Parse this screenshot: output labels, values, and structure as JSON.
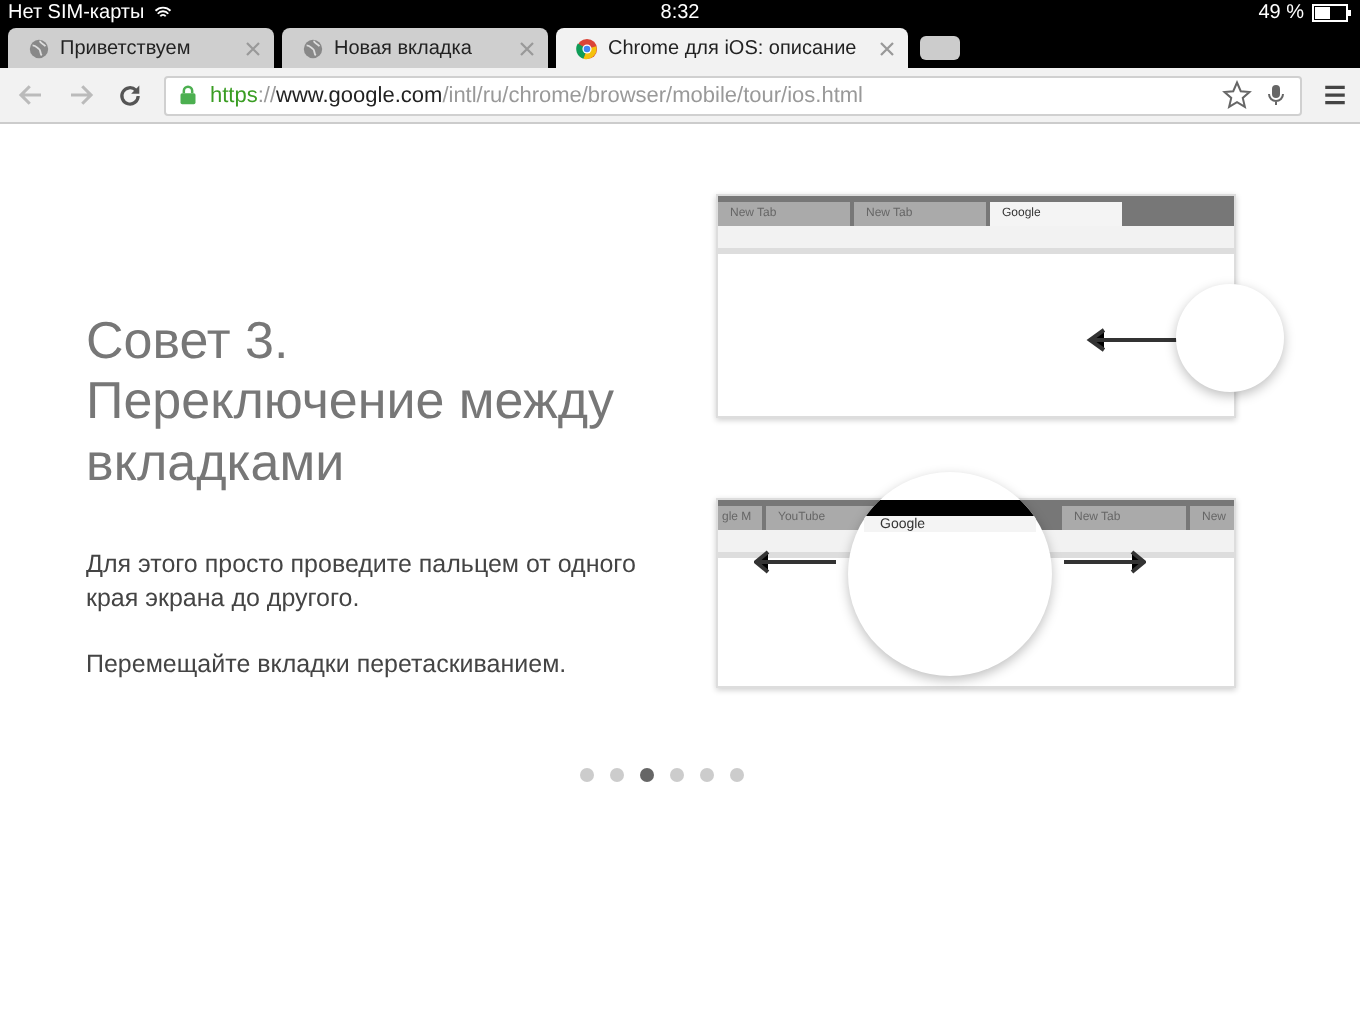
{
  "status_bar": {
    "carrier": "Нет SIM-карты",
    "time": "8:32",
    "battery": "49 %"
  },
  "tabs": [
    {
      "title": "Приветствуем",
      "kind": "globe",
      "selected": false
    },
    {
      "title": "Новая вкладка",
      "kind": "globe",
      "selected": false
    },
    {
      "title": "Chrome для iOS: описание",
      "kind": "chrome",
      "selected": true
    }
  ],
  "address_bar": {
    "secure": true,
    "scheme": "https",
    "separator": "://",
    "host": "www.google.com",
    "path": "/intl/ru/chrome/browser/mobile/tour/ios.html"
  },
  "slide": {
    "title_lines": [
      "Совет 3.",
      "Переключение между",
      "вкладками"
    ],
    "paragraphs": [
      "Для этого просто проведите пальцем от одного края экрана до другого.",
      "Перемещайте вкладки перетаскиванием."
    ],
    "illustrations": [
      {
        "tabs": [
          {
            "title": "New Tab",
            "selected": false
          },
          {
            "title": "New Tab",
            "selected": false
          },
          {
            "title": "Google",
            "selected": true
          }
        ]
      },
      {
        "tabs": [
          {
            "title": "gle M",
            "selected": false
          },
          {
            "title": "YouTube",
            "selected": false
          },
          {
            "title": "Google",
            "selected": true
          },
          {
            "title": "New Tab",
            "selected": false
          },
          {
            "title": "New",
            "selected": false
          }
        ]
      }
    ]
  },
  "pager": [
    {
      "selected": false
    },
    {
      "selected": false
    },
    {
      "selected": true
    },
    {
      "selected": false
    },
    {
      "selected": false
    },
    {
      "selected": false
    }
  ]
}
